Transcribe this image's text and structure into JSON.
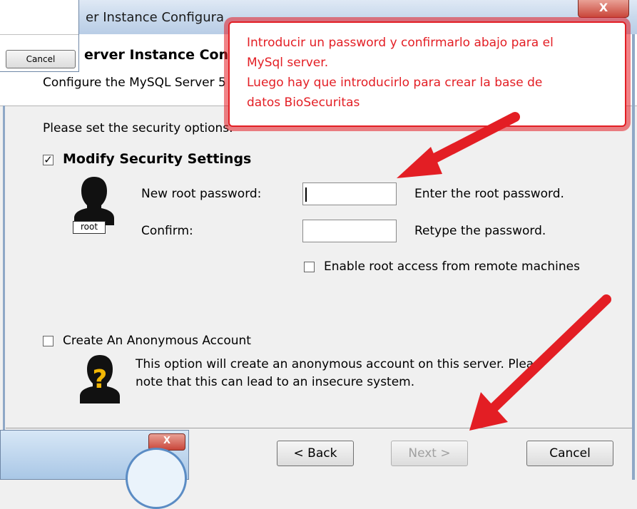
{
  "window": {
    "title": "er Instance Configura",
    "close_glyph": "X"
  },
  "header": {
    "title": "erver Instance Con",
    "subtitle": "Configure the MySQL Server 5"
  },
  "intro": "Please set the security options.",
  "security": {
    "modify_label": "Modify Security Settings",
    "modify_checked": "✓",
    "root_tag": "root",
    "new_password_label": "New root password:",
    "new_password_hint": "Enter the root password.",
    "confirm_label": "Confirm:",
    "confirm_hint": "Retype the password.",
    "remote_label": "Enable root access from remote machines"
  },
  "anonymous": {
    "label": "Create An Anonymous Account",
    "desc_line1": "This option will create an anonymous account on this server. Plea",
    "desc_line2": "note that this can lead to an insecure system."
  },
  "buttons": {
    "back": "< Back",
    "next": "Next >",
    "cancel": "Cancel"
  },
  "background_window": {
    "cancel": "Cancel",
    "close_glyph": "X"
  },
  "callout": {
    "line1": "Introducir un password y confirmarlo abajo para el",
    "line2": "MySql server.",
    "line3": "Luego hay que introducirlo para crear la base de",
    "line4": "datos  BioSecuritas"
  },
  "colors": {
    "annotation_red": "#e31e24",
    "titlebar_blue": "#c9d9ec"
  }
}
